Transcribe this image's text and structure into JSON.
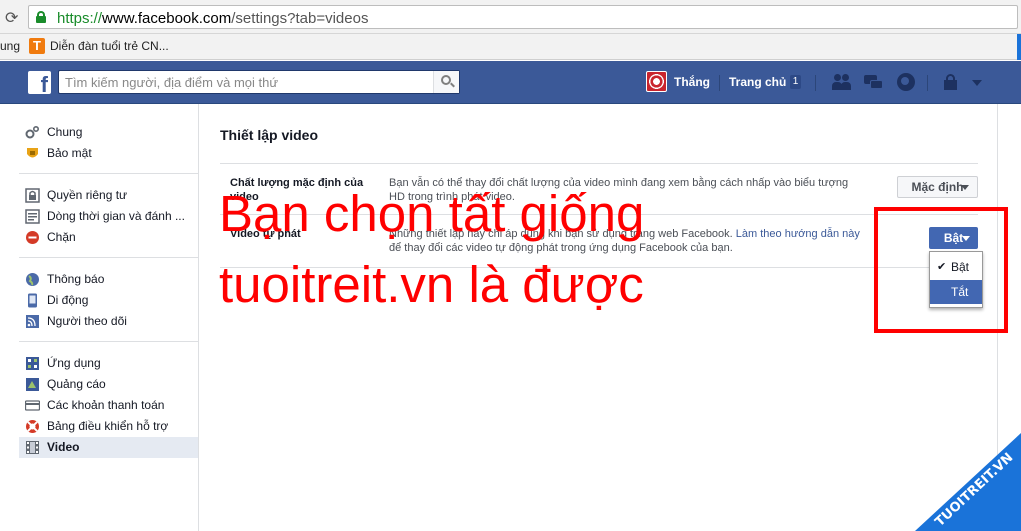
{
  "browser": {
    "url_scheme": "https://",
    "url_host": "www.facebook.com",
    "url_path": "/settings?tab=videos",
    "bookmarks": [
      {
        "label": "ung"
      },
      {
        "label": "Diễn đàn tuổi trẻ CN...",
        "icon_text": "T"
      }
    ]
  },
  "fb_header": {
    "logo": "f",
    "search_placeholder": "Tìm kiếm người, địa điểm và mọi thứ",
    "user_name": "Thắng",
    "home_label": "Trang chủ",
    "home_count": "1",
    "icons": [
      "friends-icon",
      "messages-icon",
      "notifications-globe-icon",
      "privacy-lock-icon",
      "account-caret-icon"
    ]
  },
  "sidebar": {
    "groups": [
      [
        {
          "label": "Chung",
          "icon": "gear-icon"
        },
        {
          "label": "Bảo mật",
          "icon": "shield-icon"
        }
      ],
      [
        {
          "label": "Quyền riêng tư",
          "icon": "privacy-lock-icon"
        },
        {
          "label": "Dòng thời gian và đánh ...",
          "icon": "timeline-icon"
        },
        {
          "label": "Chặn",
          "icon": "block-icon"
        }
      ],
      [
        {
          "label": "Thông báo",
          "icon": "globe-icon"
        },
        {
          "label": "Di động",
          "icon": "mobile-icon"
        },
        {
          "label": "Người theo dõi",
          "icon": "rss-icon"
        }
      ],
      [
        {
          "label": "Ứng dụng",
          "icon": "apps-icon"
        },
        {
          "label": "Quảng cáo",
          "icon": "ads-icon"
        },
        {
          "label": "Các khoản thanh toán",
          "icon": "payment-card-icon"
        },
        {
          "label": "Bảng điều khiển hỗ trợ",
          "icon": "lifebuoy-icon"
        },
        {
          "label": "Video",
          "icon": "film-icon",
          "active": true
        }
      ]
    ]
  },
  "main": {
    "title": "Thiết lập video",
    "rows": [
      {
        "label_line1": "Chất lượng mặc định của",
        "label_line2": "video",
        "desc_line1": "Bạn vẫn có thể thay đổi chất lượng của video mình đang xem bằng cách nhấp vào biểu tượng",
        "desc_line2": "HD trong trình phát video.",
        "button": "Mặc định"
      },
      {
        "label_line1": "Video tự phát",
        "desc_line1_text": "Những thiết lập này chỉ áp dụng khi bạn sử dụng trang web Facebook. ",
        "desc_line1_link": "Làm theo hướng dẫn này",
        "desc_line2": "để thay đổi các video tự động phát trong ứng dụng Facebook của bạn.",
        "button": "Bật"
      }
    ],
    "dropdown": {
      "options": [
        {
          "label": "Bật",
          "checked": true
        },
        {
          "label": "Tắt",
          "highlighted": true
        }
      ],
      "check_glyph": "✔"
    }
  },
  "overlay": {
    "line1": "Bạn chọn tất giống",
    "line2": "tuoitreit.vn là được",
    "color": "#ff0000",
    "watermark": "TUOITREIT.VN"
  },
  "colors": {
    "fb_blue": "#3b5998",
    "button_blue": "#4267b2",
    "annotation_red": "#ff0000",
    "watermark_blue": "#1a73d9"
  }
}
